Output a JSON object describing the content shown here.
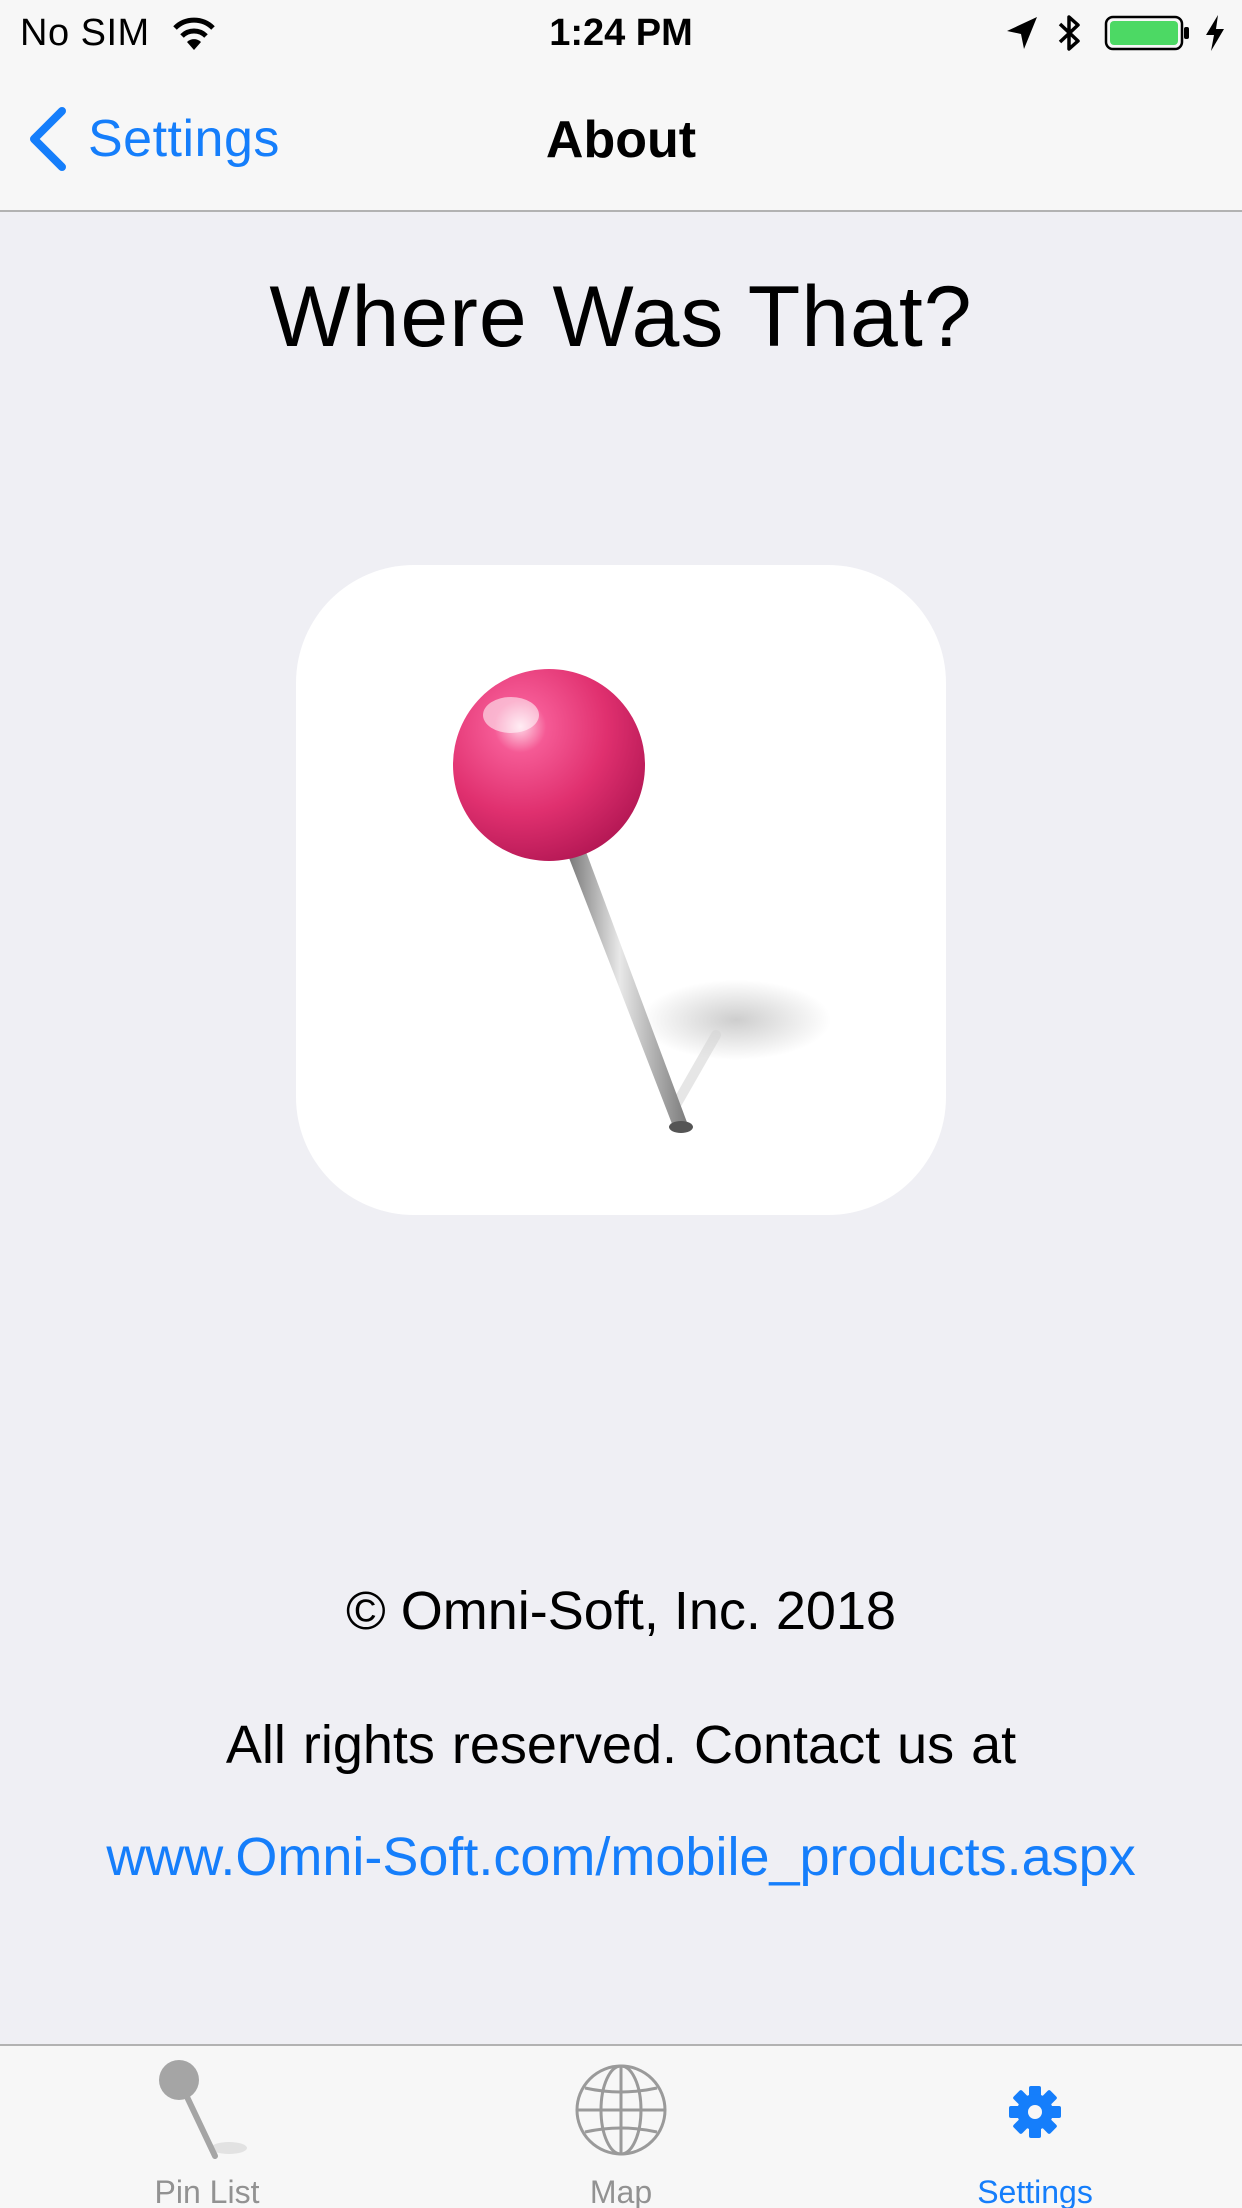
{
  "status_bar": {
    "carrier": "No SIM",
    "time": "1:24 PM",
    "battery_color": "#4cd964"
  },
  "nav": {
    "back_label": "Settings",
    "title": "About"
  },
  "content": {
    "app_title": "Where Was That?",
    "copyright": "© Omni-Soft, Inc. 2018",
    "rights": "All rights reserved.  Contact us at",
    "website": "www.Omni-Soft.com/mobile_products.aspx"
  },
  "tab_bar": {
    "tabs": [
      {
        "label": "Pin List",
        "icon": "pin-icon",
        "active": false
      },
      {
        "label": "Map",
        "icon": "globe-icon",
        "active": false
      },
      {
        "label": "Settings",
        "icon": "gear-icon",
        "active": true
      }
    ]
  },
  "colors": {
    "accent": "#157efb",
    "pin_head": "#e0306f",
    "inactive": "#929292"
  }
}
